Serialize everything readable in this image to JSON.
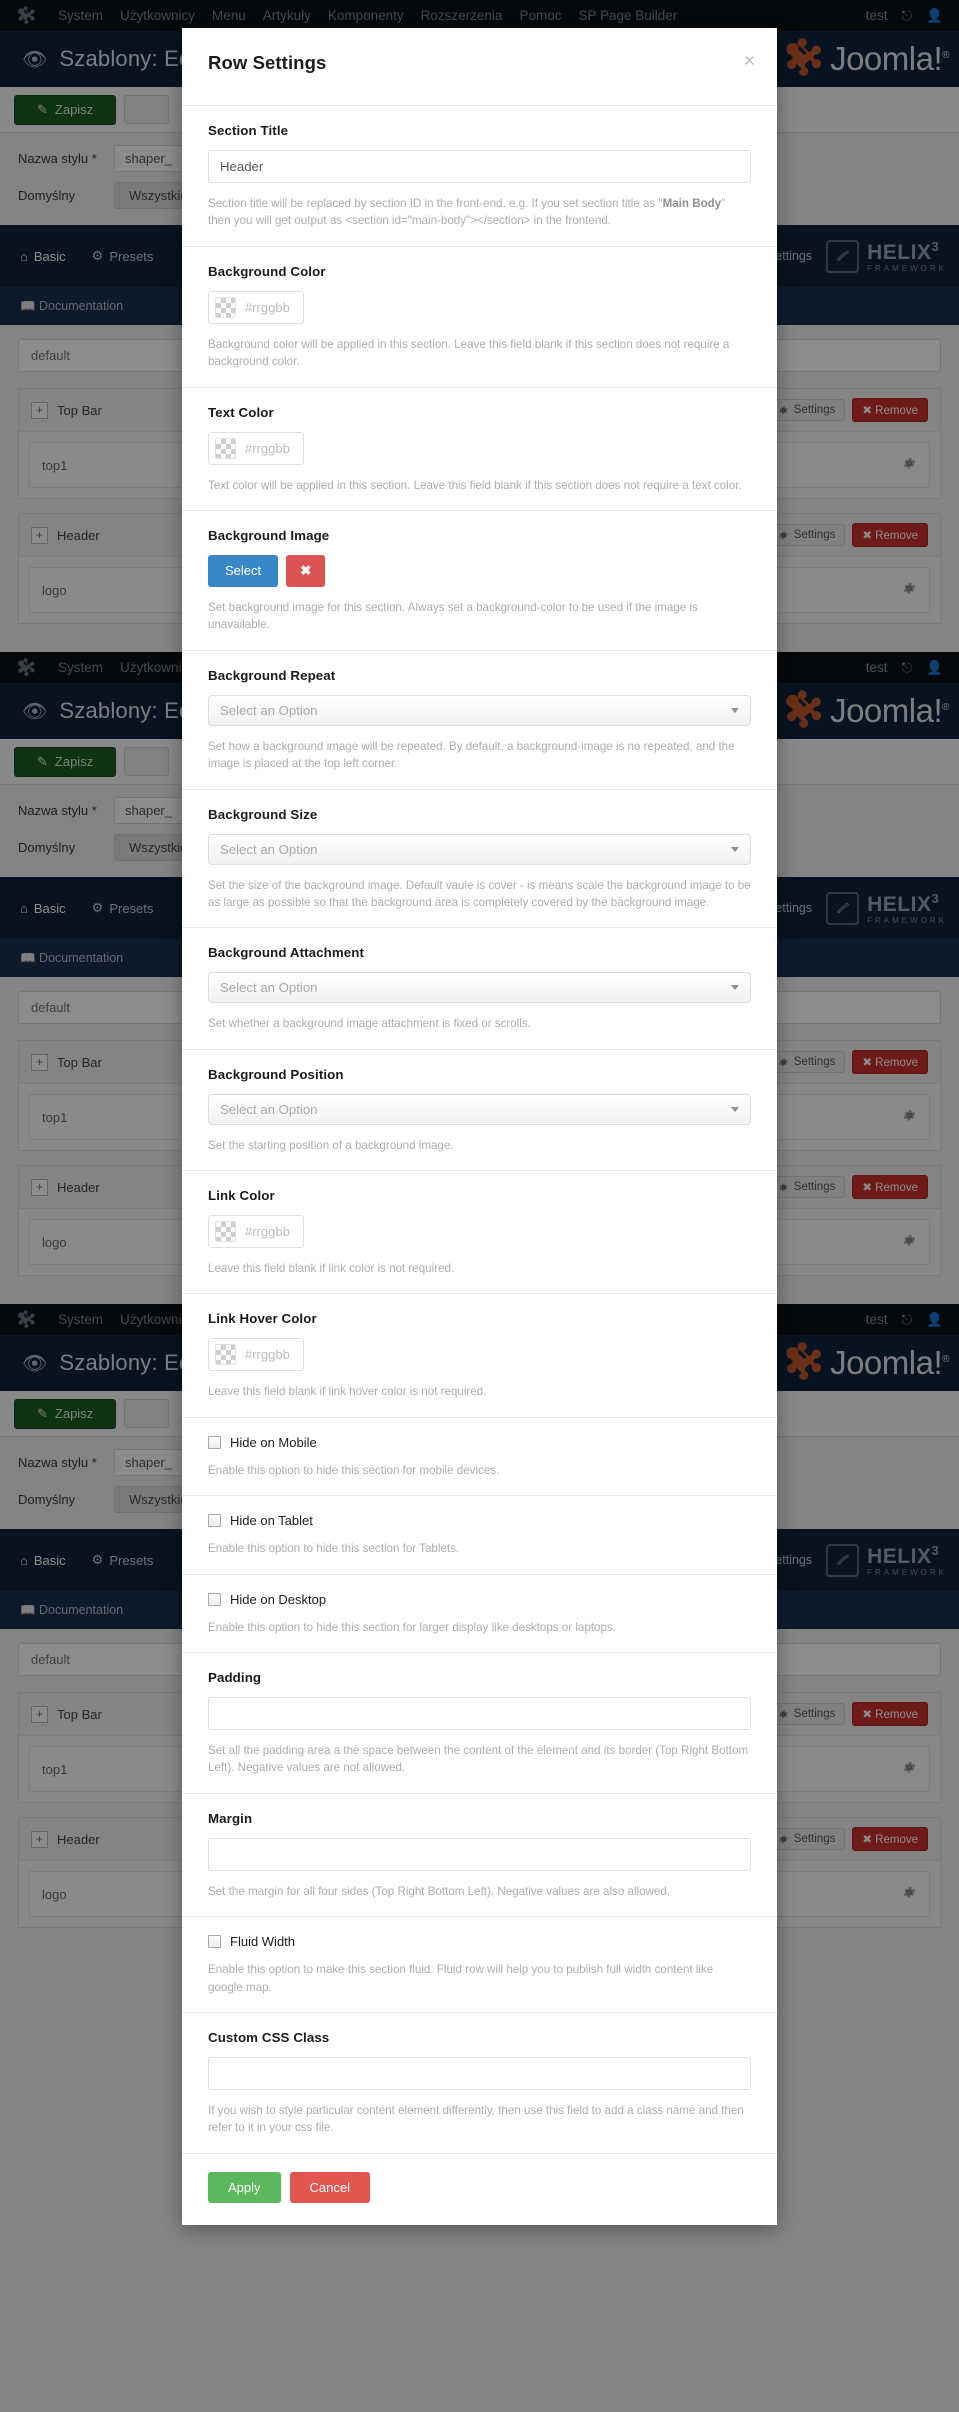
{
  "admin_bar": {
    "logo_icon": "joomla-logo-icon",
    "menu": [
      "System",
      "Użytkownicy",
      "Menu",
      "Artykuły",
      "Komponenty",
      "Rozszerzenia",
      "Pomoc",
      "SP Page Builder"
    ],
    "user_label": "test",
    "external_icon": "external-link-icon",
    "profile_icon": "user-icon"
  },
  "subheader": {
    "eye_icon": "eye-icon",
    "page_title": "Szablony: Ed",
    "brand_name": "Joomla!",
    "brand_sup": "®"
  },
  "toolbar": {
    "save_label": "Zapisz",
    "save_icon": "pencil-square-icon",
    "secondary_label": ""
  },
  "style_form": {
    "name_label": "Nazwa stylu *",
    "name_value": "shaper_",
    "default_label": "Domyślny",
    "default_value": "Wszystkie"
  },
  "helix_nav": {
    "items": [
      {
        "label": "Basic",
        "icon": "home-icon",
        "active": true
      },
      {
        "label": "Presets",
        "icon": "wrench-icon",
        "active": false
      }
    ],
    "doc_label": "Documentation",
    "doc_icon": "book-icon",
    "update_label": "Update Settings",
    "update_icon": "refresh-icon",
    "brand_line1": "HELIX",
    "brand_sup": "3",
    "brand_line2": "FRAMEWORK"
  },
  "builder": {
    "search_value": "default",
    "rows": [
      {
        "title": "Top Bar",
        "plus_icon": "plus-icon",
        "settings_label": "Settings",
        "settings_icon": "gears-icon",
        "remove_label": "Remove",
        "remove_icon": "times-icon",
        "body_label": "top1",
        "body_icon": "gears-icon"
      },
      {
        "title": "Header",
        "plus_icon": "plus-icon",
        "settings_label": "Settings",
        "settings_icon": "gears-icon",
        "remove_label": "Remove",
        "remove_icon": "times-icon",
        "body_label": "logo",
        "body_icon": "gears-icon"
      }
    ]
  },
  "modal": {
    "title": "Row Settings",
    "close_icon": "close-icon",
    "close_label": "×",
    "fields": {
      "section_title": {
        "label": "Section Title",
        "value": "Header",
        "placeholder": "",
        "help_before": "Section title will be replaced by section ID in the front-end. e.g. If you set section title as \"",
        "help_bold1": "Main Body",
        "help_after": "\" then you will get output as <section id=\"main-body\"></section> in the frontend."
      },
      "background_color": {
        "label": "Background Color",
        "placeholder": "#rrggbb",
        "value": "",
        "swatch_icon": "color-swatch-icon",
        "help": "Background color will be applied in this section. Leave this field blank if this section does not require a background color."
      },
      "text_color": {
        "label": "Text Color",
        "placeholder": "#rrggbb",
        "value": "",
        "swatch_icon": "color-swatch-icon",
        "help": "Text color will be applied in this section. Leave this field blank if this section does not require a text color."
      },
      "background_image": {
        "label": "Background Image",
        "select_label": "Select",
        "clear_icon": "times-icon",
        "clear_label": "✖",
        "help": "Set background image for this section. Always set a background-color to be used if the image is unavailable."
      },
      "background_repeat": {
        "label": "Background Repeat",
        "selected": "Select an Option",
        "caret_icon": "chevron-down-icon",
        "help": "Set how a background image will be repeated. By default, a background-image is no repeated, and the image is placed at the top left corner."
      },
      "background_size": {
        "label": "Background Size",
        "selected": "Select an Option",
        "caret_icon": "chevron-down-icon",
        "help": "Set the size of the background image. Default vaule is cover - is means scale the background image to be as large as possible so that the background area is completely covered by the background image."
      },
      "background_attachment": {
        "label": "Background Attachment",
        "selected": "Select an Option",
        "caret_icon": "chevron-down-icon",
        "help": "Set whether a background image attachment is fixed or scrolls."
      },
      "background_position": {
        "label": "Background Position",
        "selected": "Select an Option",
        "caret_icon": "chevron-down-icon",
        "help": "Set the starting position of a background image."
      },
      "link_color": {
        "label": "Link Color",
        "placeholder": "#rrggbb",
        "value": "",
        "swatch_icon": "color-swatch-icon",
        "help": "Leave this field blank if link color is not required."
      },
      "link_hover_color": {
        "label": "Link Hover Color",
        "placeholder": "#rrggbb",
        "value": "",
        "swatch_icon": "color-swatch-icon",
        "help": "Leave this field blank if link hover color is not required."
      },
      "hide_on_mobile": {
        "label": "Hide on Mobile",
        "checked": false,
        "help": "Enable this option to hide this section for mobile devices."
      },
      "hide_on_tablet": {
        "label": "Hide on Tablet",
        "checked": false,
        "help": "Enable this option to hide this section for Tablets."
      },
      "hide_on_desktop": {
        "label": "Hide on Desktop",
        "checked": false,
        "help": "Enable this option to hide this section for larger display like desktops or laptops."
      },
      "padding": {
        "label": "Padding",
        "value": "",
        "placeholder": "",
        "help": "Set all the padding area a the space between the content of the element and its border (Top Right Bottom Left). Negative values are not allowed."
      },
      "margin": {
        "label": "Margin",
        "value": "",
        "placeholder": "",
        "help": "Set the margin for all four sides (Top Right Bottom Left). Negative values are also allowed."
      },
      "fluid_width": {
        "label": "Fluid Width",
        "checked": false,
        "help": "Enable this option to make this section fluid. Fluid row will help you to publish full width content like google map."
      },
      "custom_css_class": {
        "label": "Custom CSS Class",
        "value": "",
        "placeholder": "",
        "help": "If you wish to style particular content element differently, then use this field to add a class name and then refer to it in your css file."
      }
    },
    "footer": {
      "apply_label": "Apply",
      "cancel_label": "Cancel"
    }
  },
  "colors": {
    "admin_bar_bg": "#0b1116",
    "subheader_bg": "#10233f",
    "save_green": "#1b5e20",
    "apply_green": "#5cb85c",
    "cancel_red": "#e2564f",
    "select_blue": "#3a87c8",
    "clear_red": "#db5452",
    "remove_red": "#c9302c"
  }
}
